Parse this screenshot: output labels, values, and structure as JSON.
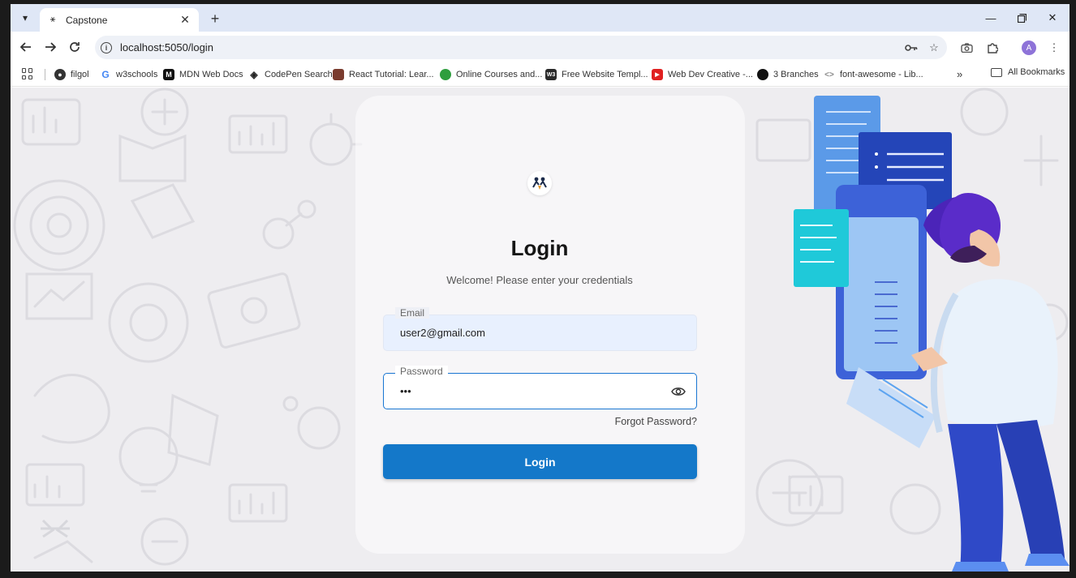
{
  "browser": {
    "tab": {
      "title": "Capstone"
    },
    "url": "localhost:5050/login",
    "profile_initial": "A",
    "bookmarks": [
      {
        "label": "filgol",
        "icon": "filgol-icon",
        "color": "#333333"
      },
      {
        "label": "w3schools",
        "icon": "google-icon",
        "color": "#4285f4"
      },
      {
        "label": "MDN Web Docs",
        "icon": "mdn-icon",
        "color": "#111111"
      },
      {
        "label": "CodePen Search",
        "icon": "codepen-icon",
        "color": "#222222"
      },
      {
        "label": "React Tutorial: Lear...",
        "icon": "react-tutorial-icon",
        "color": "#7a3b2e"
      },
      {
        "label": "Online Courses and...",
        "icon": "courses-icon",
        "color": "#2e9e3e"
      },
      {
        "label": "Free Website Templ...",
        "icon": "w3-icon",
        "color": "#2a2a2a"
      },
      {
        "label": "Web Dev Creative -...",
        "icon": "youtube-icon",
        "color": "#e02020"
      },
      {
        "label": "3 Branches",
        "icon": "github-icon",
        "color": "#111111"
      },
      {
        "label": "font-awesome - Lib...",
        "icon": "code-icon",
        "color": "#888888"
      }
    ],
    "all_bookmarks_label": "All Bookmarks"
  },
  "login": {
    "title": "Login",
    "subtitle": "Welcome! Please enter your credentials",
    "email": {
      "label": "Email",
      "value": "user2@gmail.com"
    },
    "password": {
      "label": "Password",
      "value": "•••"
    },
    "forgot": "Forgot Password?",
    "submit": "Login"
  },
  "colors": {
    "primary": "#1478c9",
    "focus_border": "#1976d2",
    "autofill_bg": "#e8f0fe"
  }
}
